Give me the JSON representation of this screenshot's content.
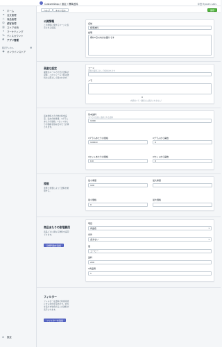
{
  "app": {
    "breadcrumb": "CustomShop / 設定 / 標準送料",
    "account": "中田 Ryosen Labs"
  },
  "sidebar": {
    "items": [
      {
        "label": "ホーム",
        "icon": "home-icon",
        "glyph": "⌂"
      },
      {
        "label": "注文管理",
        "icon": "orders-icon",
        "glyph": "≡"
      },
      {
        "label": "商品管理",
        "icon": "products-icon",
        "glyph": "◇"
      },
      {
        "label": "顧客管理",
        "icon": "customers-icon",
        "glyph": "☺"
      },
      {
        "label": "ストア分析",
        "icon": "analytics-icon",
        "glyph": "▥"
      },
      {
        "label": "マーケティング",
        "icon": "marketing-icon",
        "glyph": "✦"
      },
      {
        "label": "ディスカウント",
        "icon": "discount-icon",
        "glyph": "%"
      },
      {
        "label": "アプリ管理",
        "icon": "apps-icon",
        "glyph": "⊞"
      }
    ],
    "section_label": "販売チャネル",
    "channel": {
      "label": "オンラインストア",
      "glyph": "◉"
    },
    "settings": {
      "label": "設定",
      "glyph": "⚙"
    }
  },
  "toolbar": {
    "help": "ヘルプ",
    "cancel": "キャンセル",
    "save": "保存"
  },
  "sections": {
    "public": {
      "title": "公開情報",
      "desc": "この送料に関するページに表示される情報。",
      "name_label": "名前",
      "name_value": "標準送料",
      "desc_label": "説明",
      "desc_value": "概ね5日以内のお届けです"
    },
    "advanced": {
      "title": "高度な設定",
      "desc": "複数のルールでの合計送料計算時、このフィールド値は送料の上限として扱われます。",
      "code_label": "コード",
      "code_help": "送料の識別子として使用されます",
      "memo_label": "メモ",
      "memo_help": "内部用メモ（顧客には表示されません）",
      "memo_count": "0"
    },
    "base": {
      "title": "",
      "desc": "基本送料とその他の料金設定。注文の総重量、1グラムあたりの価格、1セットあたりの価格を組み合わせて計算されます。",
      "base_label": "基本送料",
      "base_help": "すべての注文に適用される送料",
      "base_value": "1000",
      "g_price_label": "1グラムあたりの価格",
      "g_price_value": "1000.0",
      "g_from_label": "Xグラムから開始",
      "g_from_value": "0",
      "set_price_label": "1セットあたりの価格",
      "set_price_value": "0.0",
      "set_from_label": "Xセットから開始",
      "set_from_value": "0"
    },
    "stage": {
      "title": "段階",
      "desc": "重量と重量によって送料を制限する。",
      "min_weight_label": "最小重量",
      "min_weight_value": "100",
      "max_weight_label": "最大重量",
      "max_weight_value": "",
      "min_price_label": "最小価格",
      "min_price_value": "0",
      "max_price_label": "最大価格",
      "max_price_value": ""
    },
    "product": {
      "title": "商品あたりの割増費用",
      "desc": "商品ごとに異なる送料を設定できます。",
      "add_button": "割増料金を追加",
      "type_label": "項目",
      "type_value": "商品名",
      "cond_label": "条件",
      "cond_value": "含まない",
      "value_label": "値",
      "value_value": "コーヒー",
      "fee_label": "送料",
      "fee_value": "200",
      "qty_label": "X商品毎",
      "qty_value": "1"
    },
    "filter": {
      "title": "フィルター",
      "desc": "フィルターは送料を利用可能にする条件を定めます。条件を満たす場合のみこの送料が表示されます。",
      "add_button": "フィルターを追加"
    }
  }
}
